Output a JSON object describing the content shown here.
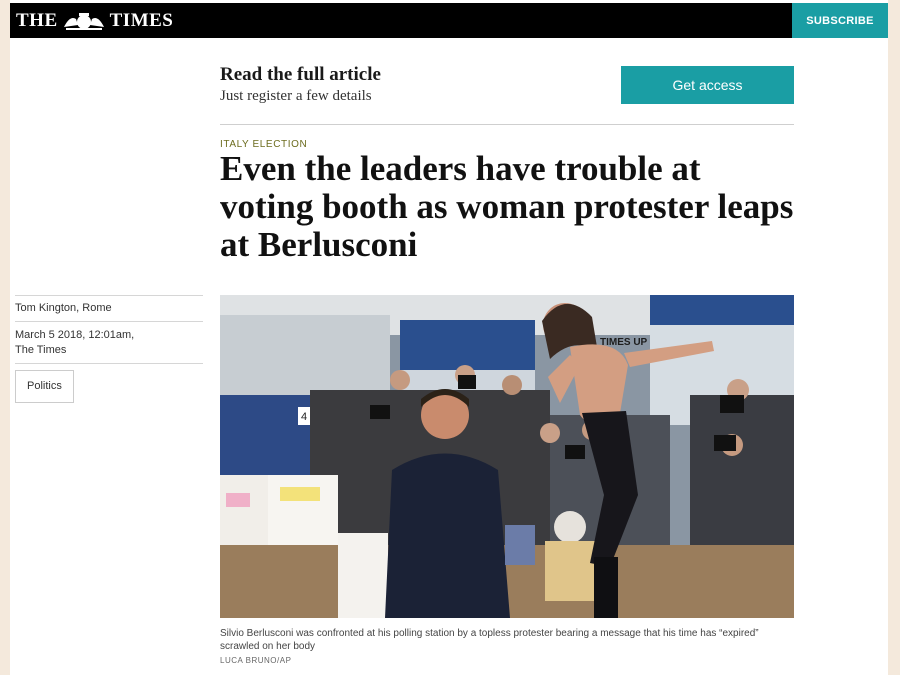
{
  "masthead": {
    "logo_left": "THE",
    "logo_right": "TIMES",
    "crest_icon": "royal-crest-icon",
    "subscribe_label": "SUBSCRIBE",
    "background": "#000000",
    "accent": "#1a9ea4"
  },
  "promo": {
    "title": "Read the full article",
    "subtitle": "Just register a few details",
    "button_label": "Get access"
  },
  "article": {
    "section": "ITALY ELECTION",
    "headline": "Even the leaders have trouble at voting booth as woman protester leaps at Berlusconi",
    "byline": "Tom Kington, Rome",
    "date": "March 5 2018, 12:01am,",
    "publication": "The Times",
    "tag": "Politics",
    "photo": {
      "ballot_number": "4",
      "body_text": "TIMES UP"
    },
    "caption": "Silvio Berlusconi was confronted at his polling station by a topless protester bearing a message that his time has “expired” scrawled on her body",
    "credit": "LUCA BRUNO/AP"
  }
}
